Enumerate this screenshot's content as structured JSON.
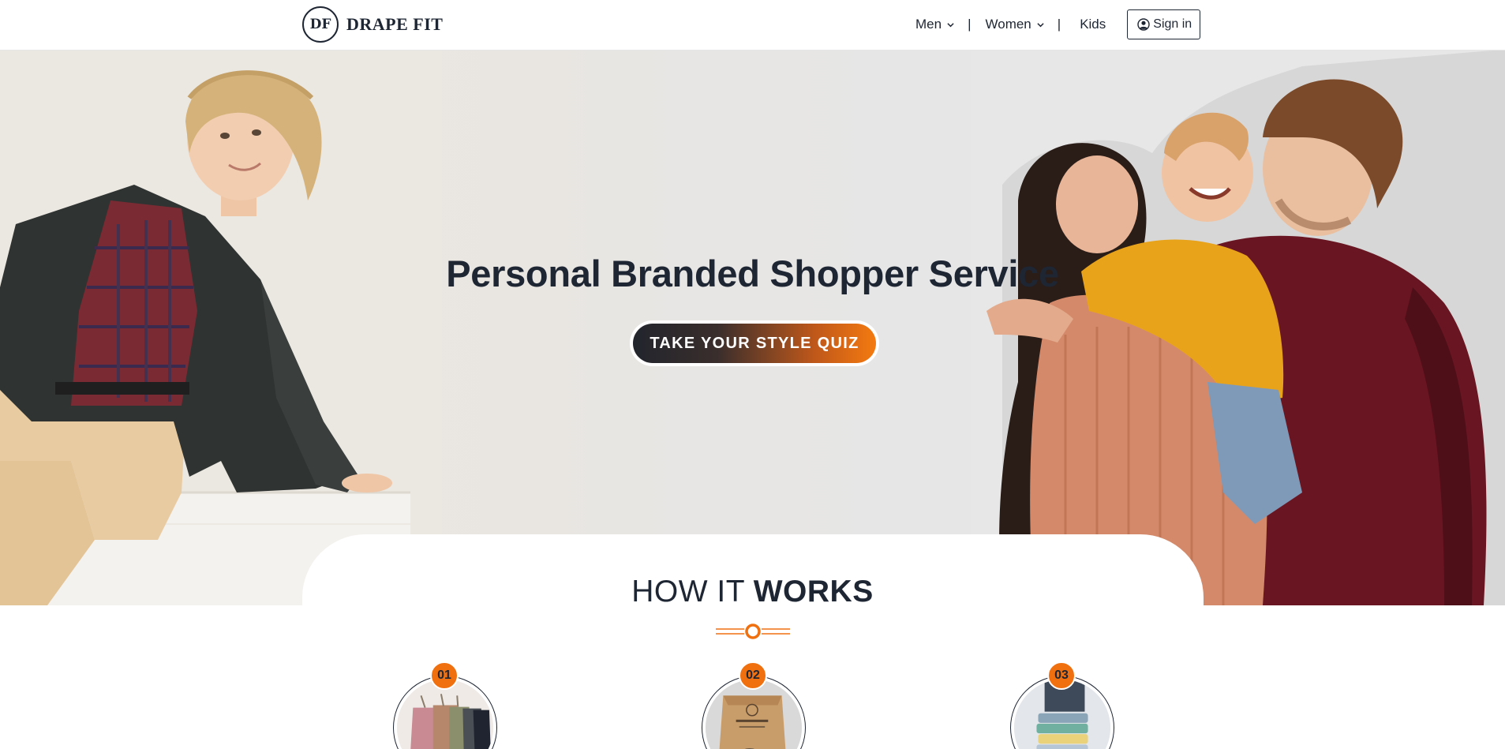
{
  "brand": {
    "mark": "DF",
    "name": "DRAPE FIT"
  },
  "nav": {
    "men": "Men",
    "separator": "|",
    "women": "Women",
    "kids": "Kids",
    "sign_in": "Sign in"
  },
  "hero": {
    "title": "Personal Branded Shopper Service",
    "cta": "TAKE YOUR STYLE QUIZ"
  },
  "how_it_works": {
    "title_light": "HOW IT",
    "title_bold": "WORKS",
    "steps": [
      {
        "number": "01",
        "image": "hanging-sweaters"
      },
      {
        "number": "02",
        "image": "drape-fit-box"
      },
      {
        "number": "03",
        "image": "folded-clothes-stack"
      }
    ]
  },
  "colors": {
    "accent": "#f07010",
    "text": "#1e2533",
    "hero_bg": "#e8e6e2"
  }
}
